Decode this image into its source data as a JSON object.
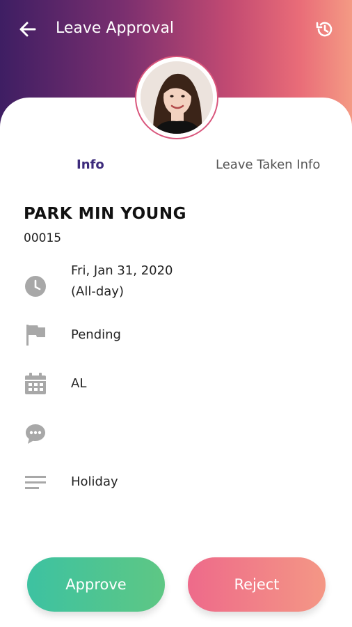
{
  "header": {
    "title": "Leave Approval",
    "back_icon": "arrow-left-icon",
    "history_icon": "history-icon",
    "gradient": [
      "#3e1e63",
      "#7a2f6f",
      "#c24a72",
      "#e96c78",
      "#f49a84"
    ]
  },
  "profile": {
    "avatar_icon": "profile-photo"
  },
  "tabs": [
    {
      "label": "Info",
      "active": true
    },
    {
      "label": "Leave Taken Info",
      "active": false
    }
  ],
  "employee": {
    "name": "PARK MIN YOUNG",
    "id": "00015"
  },
  "details": {
    "date_line1": "Fri, Jan 31, 2020",
    "date_line2": "(All-day)",
    "status": "Pending",
    "leave_type": "AL",
    "comment": "",
    "reason": "Holiday"
  },
  "actions": {
    "approve_label": "Approve",
    "reject_label": "Reject",
    "approve_color": "#4bc496",
    "reject_color": "#f07e88"
  }
}
